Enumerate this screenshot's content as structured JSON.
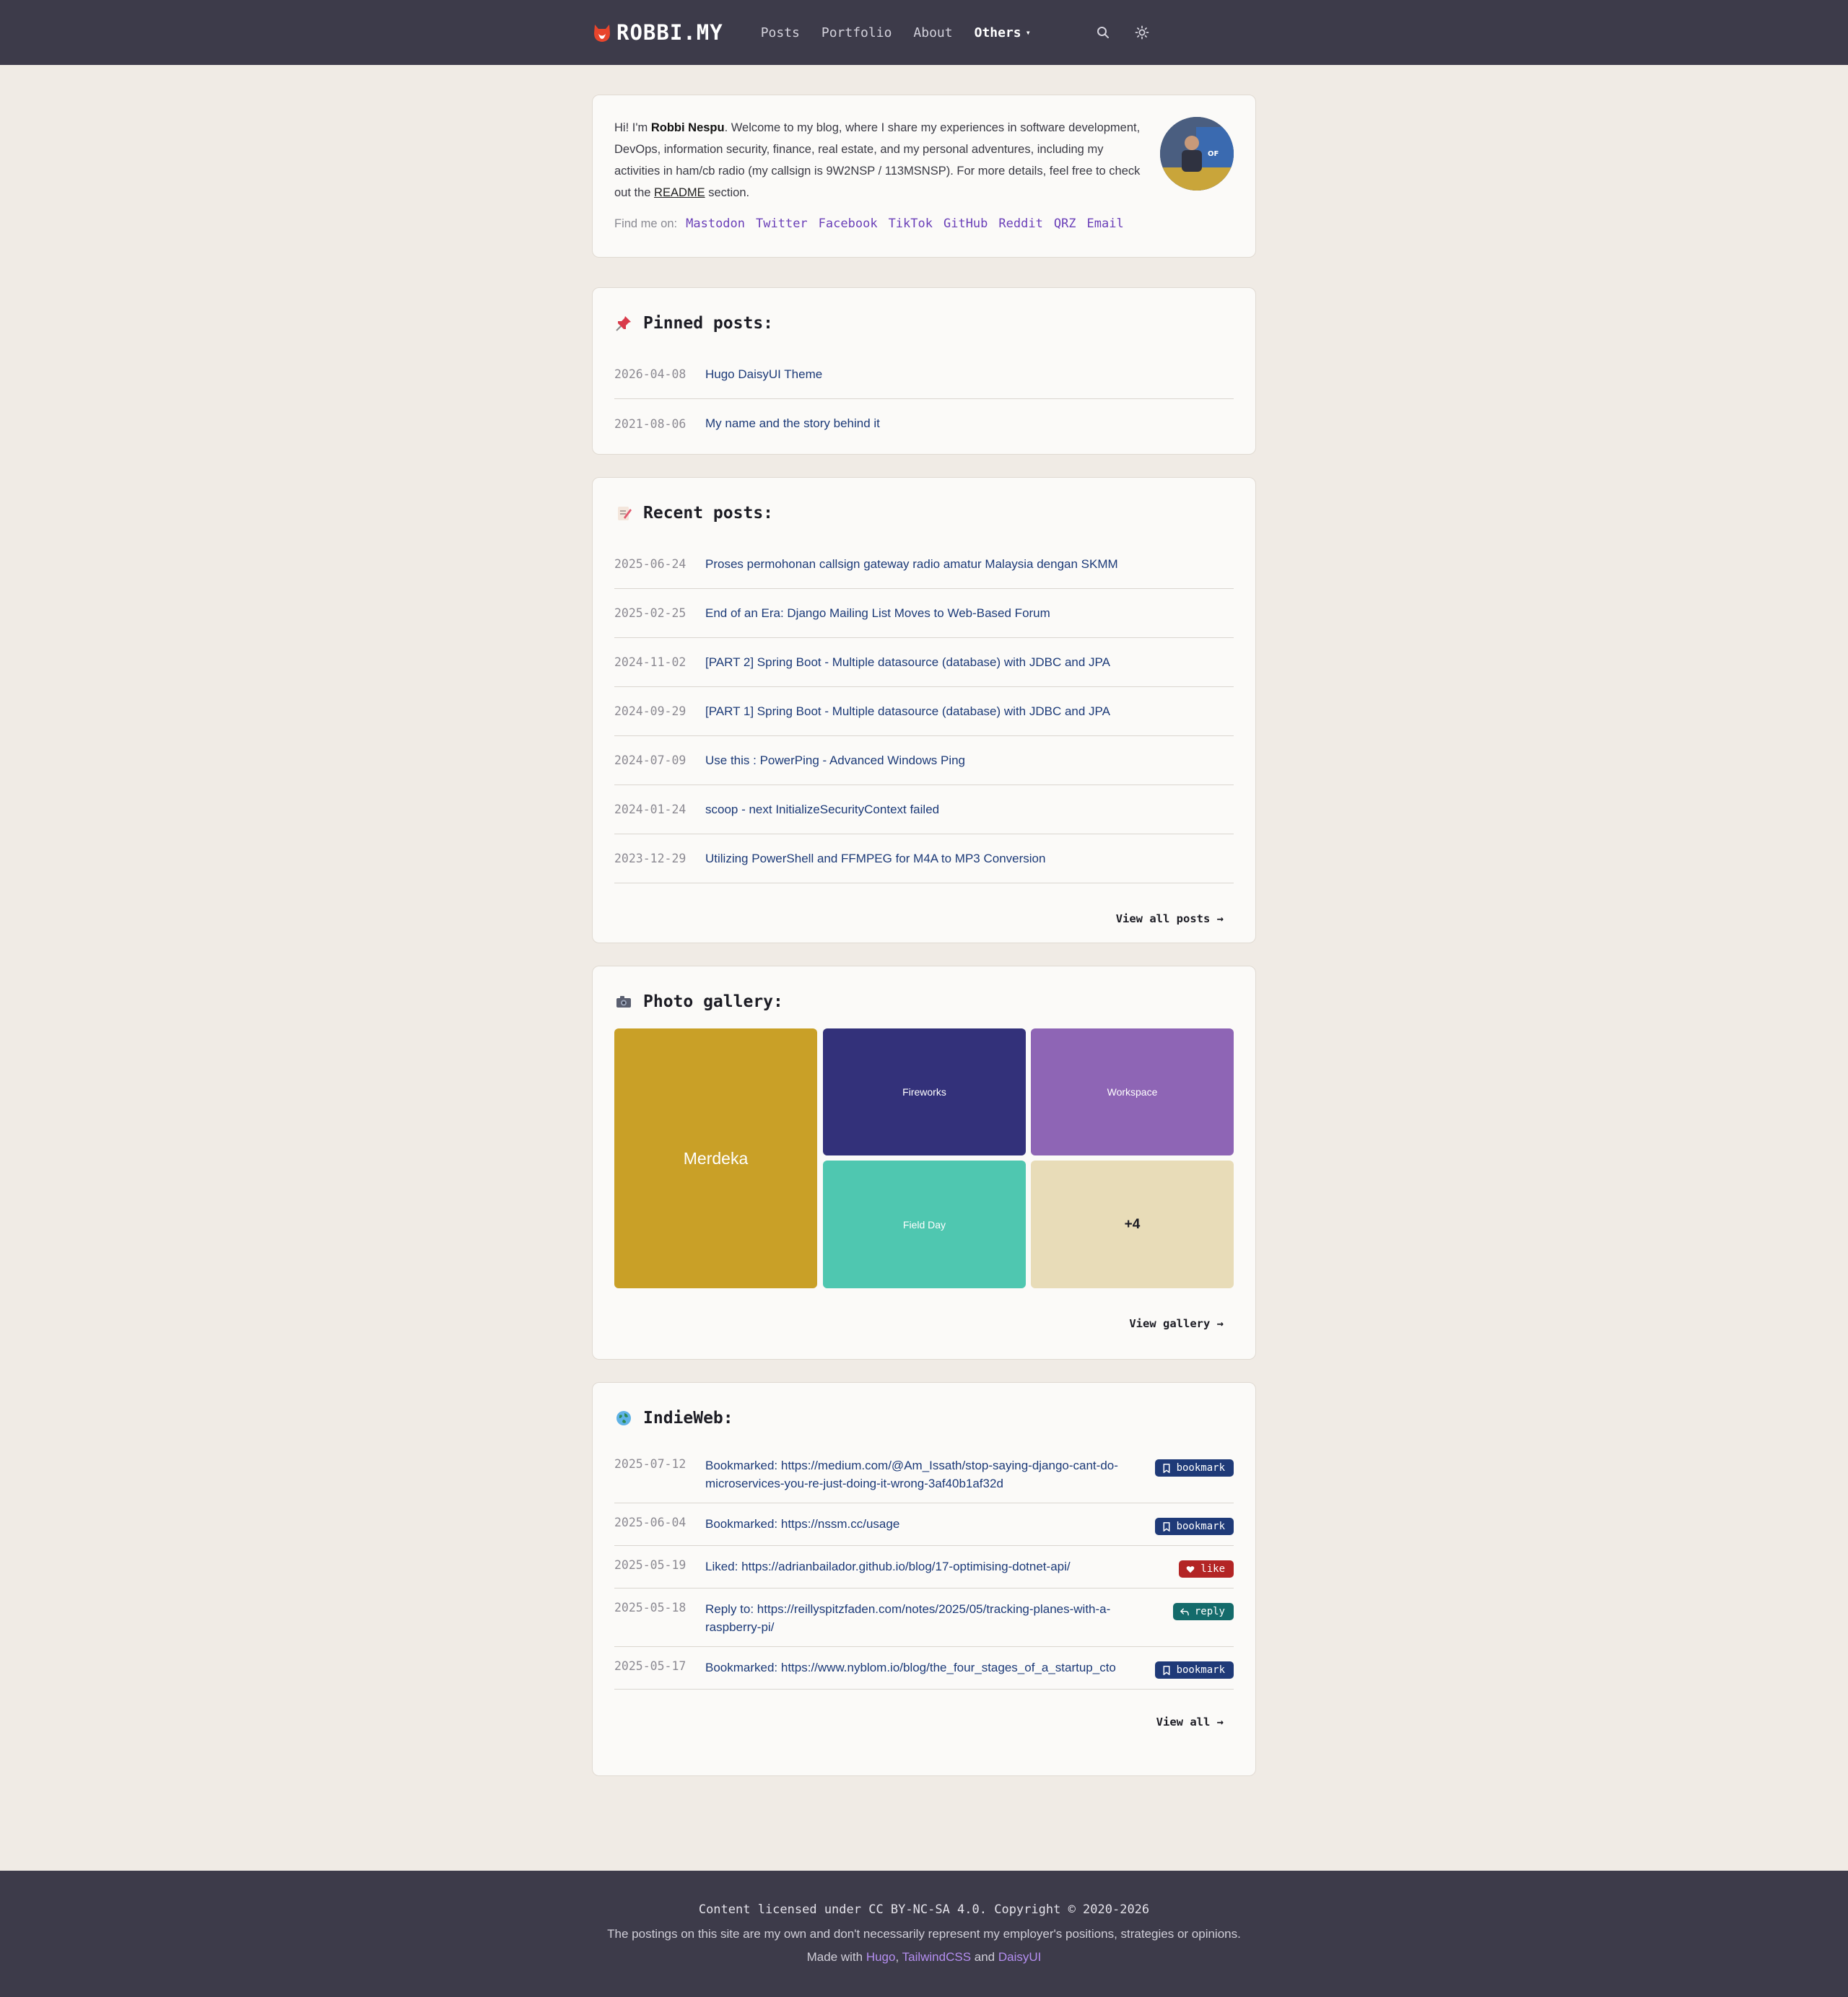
{
  "site": {
    "logo_text": "ROBBI.MY"
  },
  "nav": {
    "posts": "Posts",
    "portfolio": "Portfolio",
    "about": "About",
    "others": "Others",
    "search_icon": "search-icon",
    "theme_icon": "sun-icon"
  },
  "intro": {
    "pre": "Hi! I'm ",
    "name": "Robbi Nespu",
    "body": ". Welcome to my blog, where I share my experiences in software development, DevOps, information security, finance, real estate, and my personal adventures, including my activities in ham/cb radio (my callsign is 9W2NSP / 113MSNSP). For more details, feel free to check out the ",
    "readme": "README",
    "post": " section.",
    "findme_label": "Find me on:",
    "social": [
      "Mastodon",
      "Twitter",
      "Facebook",
      "TikTok",
      "GitHub",
      "Reddit",
      "QRZ",
      "Email"
    ]
  },
  "pinned": {
    "title": "Pinned posts:",
    "items": [
      {
        "date": "2026-04-08",
        "title": "Hugo DaisyUI Theme"
      },
      {
        "date": "2021-08-06",
        "title": "My name and the story behind it"
      }
    ]
  },
  "recent": {
    "title": "Recent posts:",
    "items": [
      {
        "date": "2025-06-24",
        "title": "Proses permohonan callsign gateway radio amatur Malaysia dengan SKMM"
      },
      {
        "date": "2025-02-25",
        "title": "End of an Era: Django Mailing List Moves to Web-Based Forum"
      },
      {
        "date": "2024-11-02",
        "title": "[PART 2] Spring Boot - Multiple datasource (database) with JDBC and JPA"
      },
      {
        "date": "2024-09-29",
        "title": "[PART 1] Spring Boot - Multiple datasource (database) with JDBC and JPA"
      },
      {
        "date": "2024-07-09",
        "title": "Use this : PowerPing - Advanced Windows Ping"
      },
      {
        "date": "2024-01-24",
        "title": "scoop - next InitializeSecurityContext failed"
      },
      {
        "date": "2023-12-29",
        "title": "Utilizing PowerShell and FFMPEG for M4A to MP3 Conversion"
      }
    ],
    "view_all": "View all posts →"
  },
  "gallery": {
    "title": "Photo gallery:",
    "tiles": [
      {
        "label": "Merdeka",
        "color": "#c9a027"
      },
      {
        "label": "Fireworks",
        "color": "#33317a"
      },
      {
        "label": "Workspace",
        "color": "#8e65b5"
      },
      {
        "label": "Field Day",
        "color": "#4fc7b0"
      },
      {
        "label": "+4",
        "color": "#e8dcb8"
      }
    ],
    "view_all": "View gallery →"
  },
  "indieweb": {
    "title": "IndieWeb:",
    "items": [
      {
        "date": "2025-07-12",
        "title": "Bookmarked: https://medium.com/@Am_Issath/stop-saying-django-cant-do-microservices-you-re-just-doing-it-wrong-3af40b1af32d",
        "badge": "bookmark"
      },
      {
        "date": "2025-06-04",
        "title": "Bookmarked: https://nssm.cc/usage",
        "badge": "bookmark"
      },
      {
        "date": "2025-05-19",
        "title": "Liked: https://adrianbailador.github.io/blog/17-optimising-dotnet-api/",
        "badge": "like"
      },
      {
        "date": "2025-05-18",
        "title": "Reply to: https://reillyspitzfaden.com/notes/2025/05/tracking-planes-with-a-raspberry-pi/",
        "badge": "reply"
      },
      {
        "date": "2025-05-17",
        "title": "Bookmarked: https://www.nyblom.io/blog/the_four_stages_of_a_startup_cto",
        "badge": "bookmark"
      }
    ],
    "view_all": "View all →"
  },
  "footer": {
    "license": "Content licensed under CC BY-NC-SA 4.0. Copyright © 2020-2026",
    "disclaimer": "The postings on this site are my own and don't necessarily represent my employer's positions, strategies or opinions.",
    "made_with": "Made with ",
    "hugo": "Hugo",
    "sep": ", ",
    "tailwind": "TailwindCSS",
    "and": " and ",
    "daisyui": "DaisyUI"
  },
  "colors": {
    "nav_bg": "#3d3b4a",
    "page_bg": "#f0ebe5",
    "link": "#1c3a78",
    "social": "#6a3fb8",
    "logo_accent": "#e8452c"
  }
}
